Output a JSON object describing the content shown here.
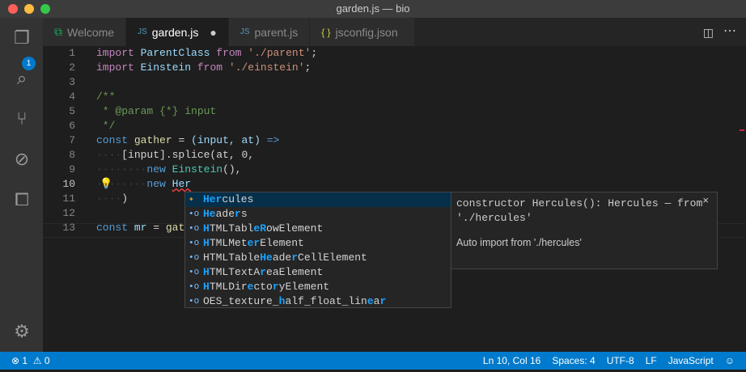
{
  "window": {
    "title": "garden.js — bio"
  },
  "activity": {
    "badge": "1",
    "items": [
      "files-icon",
      "search-icon",
      "source-control-icon",
      "debug-icon",
      "extensions-icon",
      "settings-icon"
    ]
  },
  "tabs": [
    {
      "label": "Welcome",
      "icon": "vscode-icon",
      "icon_text": "⧉"
    },
    {
      "label": "garden.js",
      "icon": "js-icon",
      "icon_text": "JS",
      "dirty": "●"
    },
    {
      "label": "parent.js",
      "icon": "js-icon",
      "icon_text": "JS"
    },
    {
      "label": "jsconfig.json",
      "icon": "json-icon",
      "icon_text": "{ }"
    }
  ],
  "lines": [
    "1",
    "2",
    "3",
    "4",
    "5",
    "6",
    "7",
    "8",
    "9",
    "10",
    "11",
    "12",
    "13"
  ],
  "code": {
    "l1": [
      "import",
      "ParentClass",
      "from",
      "'./parent'"
    ],
    "l2": [
      "import",
      "Einstein",
      "from",
      "'./einstein'"
    ],
    "l4": "/**",
    "l5": " * @param {*} input",
    "l6": " */",
    "l7": [
      "const",
      "gather",
      "=",
      "(input, at)",
      "=>"
    ],
    "l8": "[input].splice(at, 0,",
    "l9": [
      "new",
      "Einstein",
      "(),"
    ],
    "l10": [
      "new",
      "Her"
    ],
    "l11": ")",
    "l13": [
      "const",
      "mr",
      "=",
      "gath"
    ]
  },
  "suggest": {
    "items": [
      {
        "icon": "class-icon",
        "parts": [
          [
            "Her",
            1
          ],
          [
            "cules",
            0
          ]
        ]
      },
      {
        "icon": "variable-icon",
        "parts": [
          [
            "He",
            1
          ],
          [
            "ade",
            0
          ],
          [
            "r",
            1
          ],
          [
            "s",
            0
          ]
        ]
      },
      {
        "icon": "variable-icon",
        "parts": [
          [
            "H",
            1
          ],
          [
            "TMLTabl",
            0
          ],
          [
            "eR",
            1
          ],
          [
            "owElement",
            0
          ]
        ]
      },
      {
        "icon": "variable-icon",
        "parts": [
          [
            "H",
            1
          ],
          [
            "TMLMet",
            0
          ],
          [
            "er",
            1
          ],
          [
            "Element",
            0
          ]
        ]
      },
      {
        "icon": "variable-icon",
        "parts": [
          [
            "HTMLTable",
            0
          ],
          [
            "He",
            1
          ],
          [
            "ade",
            0
          ],
          [
            "r",
            1
          ],
          [
            "CellElement",
            0
          ]
        ]
      },
      {
        "icon": "variable-icon",
        "parts": [
          [
            "H",
            1
          ],
          [
            "TMLTextA",
            0
          ],
          [
            "r",
            1
          ],
          [
            "eaElement",
            0
          ]
        ]
      },
      {
        "icon": "variable-icon",
        "parts": [
          [
            "H",
            1
          ],
          [
            "TMLDir",
            0
          ],
          [
            "e",
            1
          ],
          [
            "cto",
            0
          ],
          [
            "r",
            1
          ],
          [
            "yElement",
            0
          ]
        ]
      },
      {
        "icon": "variable-icon",
        "parts": [
          [
            "OES_texture_",
            0
          ],
          [
            "h",
            1
          ],
          [
            "alf_float_lin",
            0
          ],
          [
            "e",
            1
          ],
          [
            "a",
            0
          ],
          [
            "r",
            1
          ]
        ]
      }
    ]
  },
  "details": {
    "signature": "constructor Hercules(): Hercules — from './hercules'",
    "doc": "Auto import from './hercules'",
    "close": "×"
  },
  "status": {
    "errors": "1",
    "warnings": "0",
    "position": "Ln 10, Col 16",
    "spaces": "Spaces: 4",
    "encoding": "UTF-8",
    "eol": "LF",
    "language": "JavaScript"
  }
}
